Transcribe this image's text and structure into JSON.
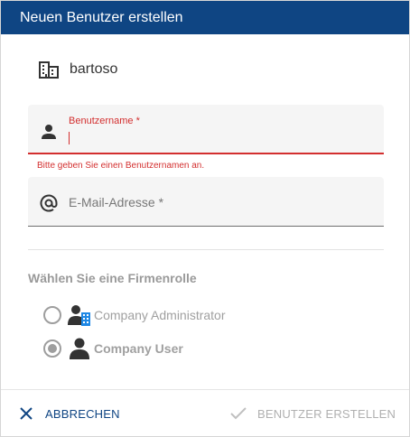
{
  "dialog": {
    "title": "Neuen Benutzer erstellen"
  },
  "company": {
    "name": "bartoso",
    "icon": "building-icon"
  },
  "form": {
    "username": {
      "label": "Benutzername *",
      "value": "",
      "error": "Bitte geben Sie einen Benutzernamen an.",
      "icon": "person-icon",
      "error_color": "#d32f2f"
    },
    "email": {
      "placeholder": "E-Mail-Adresse *",
      "value": "",
      "icon": "at-icon"
    }
  },
  "roles": {
    "heading": "Wählen Sie eine Firmenrolle",
    "options": [
      {
        "label": "Company Administrator",
        "selected": false,
        "icon": "admin-user-icon"
      },
      {
        "label": "Company User",
        "selected": true,
        "icon": "user-icon"
      }
    ]
  },
  "actions": {
    "cancel_label": "ABBRECHEN",
    "create_label": "BENUTZER ERSTELLEN",
    "create_enabled": false
  },
  "colors": {
    "header_bg": "#0f4583",
    "accent": "#0f4583",
    "error": "#d32f2f"
  }
}
